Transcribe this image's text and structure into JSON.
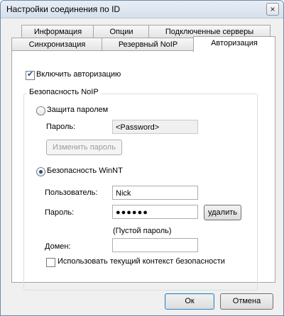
{
  "window": {
    "title": "Настройки соединения по ID",
    "close_glyph": "×"
  },
  "tabs_back": [
    "Информация",
    "Опции",
    "Подключенные серверы"
  ],
  "tabs_front": [
    "Синхронизация",
    "Резервный NoIP",
    "Авторизация"
  ],
  "auth": {
    "enable_label": "Включить авторизацию",
    "enable_checked": true,
    "group_title": "Безопасность NoIP",
    "password_protection_label": "Защита паролем",
    "password_label": "Пароль:",
    "password_placeholder": "<Password>",
    "change_password_label": "Изменить пароль",
    "winnt_label": "Безопасность WinNT",
    "user_label": "Пользователь:",
    "user_value": "Nick",
    "winnt_password_label": "Пароль:",
    "winnt_password_value": "●●●●●●",
    "delete_label": "удалить",
    "empty_password_note": "(Пустой пароль)",
    "domain_label": "Домен:",
    "domain_value": "",
    "use_current_context_label": "Использовать текущий контекст безопасности"
  },
  "footer": {
    "ok_label": "Ок",
    "cancel_label": "Отмена"
  }
}
